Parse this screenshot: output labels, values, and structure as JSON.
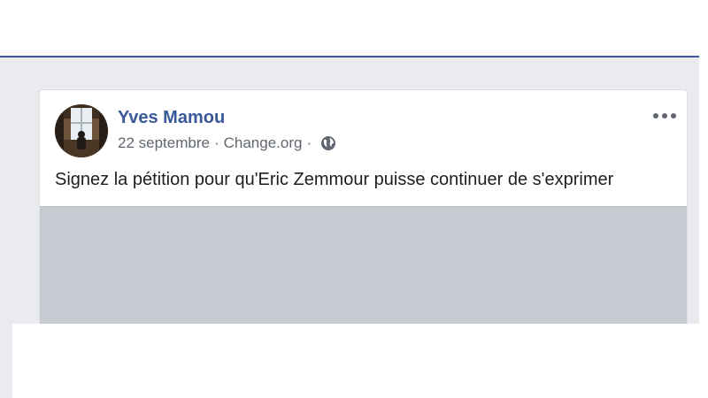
{
  "post": {
    "author": "Yves Mamou",
    "date": "22 septembre",
    "separator": "·",
    "source": "Change.org",
    "privacy_icon": "globe-icon",
    "more_icon": "more-options-icon",
    "text": "Signez la pétition pour qu'Eric Zemmour puisse continuer de s'exprimer"
  },
  "colors": {
    "brand": "#3b5998",
    "author_link": "#385898",
    "meta_text": "#606770",
    "feed_background": "#e9ebee",
    "preview_placeholder": "#c8cad1"
  }
}
